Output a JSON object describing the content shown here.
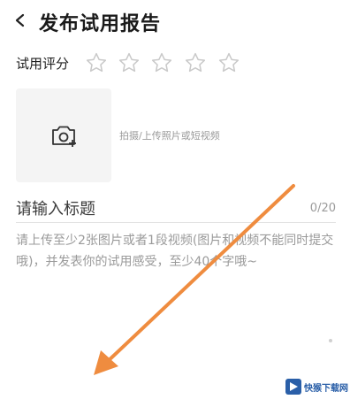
{
  "header": {
    "title": "发布试用报告",
    "back_icon": "chevron-left-icon"
  },
  "rating": {
    "label": "试用评分",
    "max_stars": 5,
    "value": 0,
    "star_icon": "star-outline-icon"
  },
  "upload": {
    "icon": "camera-plus-icon",
    "hint": "拍摄/上传照片或短视频"
  },
  "title_field": {
    "placeholder": "请输入标题",
    "counter": "0/20"
  },
  "content_field": {
    "placeholder": "请上传至少2张图片或者1段视频(图片和视频不能同时提交哦)，并发表你的试用感受，至少40个字哦~"
  },
  "watermark": {
    "text": "快猴下载网"
  },
  "colors": {
    "annotation_arrow": "#ef8c3f",
    "star_stroke": "#c9c9c9",
    "upload_bg": "#f4f4f4",
    "hint_text": "#9a9a9a"
  }
}
